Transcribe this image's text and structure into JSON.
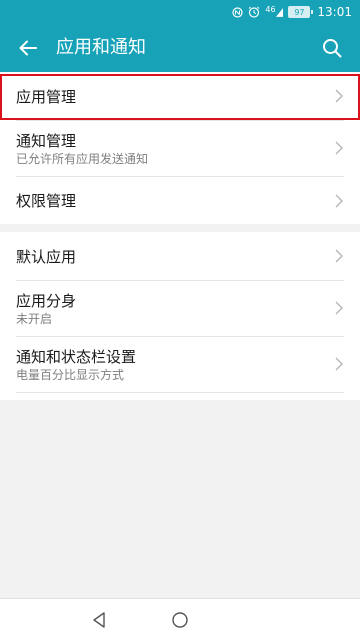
{
  "status_bar": {
    "signal_text": "46",
    "battery_level": "97",
    "time": "13:01",
    "icons": [
      "nfc-icon",
      "alarm-icon",
      "signal-icon",
      "battery-icon"
    ]
  },
  "app_bar": {
    "title": "应用和通知",
    "back_icon": "arrow-left-icon",
    "search_icon": "search-icon"
  },
  "groups": [
    {
      "items": [
        {
          "title": "应用管理",
          "subtitle": "",
          "highlighted": true
        },
        {
          "title": "通知管理",
          "subtitle": "已允许所有应用发送通知",
          "highlighted": false
        },
        {
          "title": "权限管理",
          "subtitle": "",
          "highlighted": false
        }
      ]
    },
    {
      "items": [
        {
          "title": "默认应用",
          "subtitle": ""
        },
        {
          "title": "应用分身",
          "subtitle": "未开启"
        },
        {
          "title": "通知和状态栏设置",
          "subtitle": "电量百分比显示方式"
        }
      ]
    }
  ],
  "nav_bar": {
    "icons": [
      "nav-back-icon",
      "nav-home-icon"
    ]
  },
  "colors": {
    "accent": "#17a2b8",
    "highlight": "#d9121b",
    "background": "#f2f2f2"
  }
}
